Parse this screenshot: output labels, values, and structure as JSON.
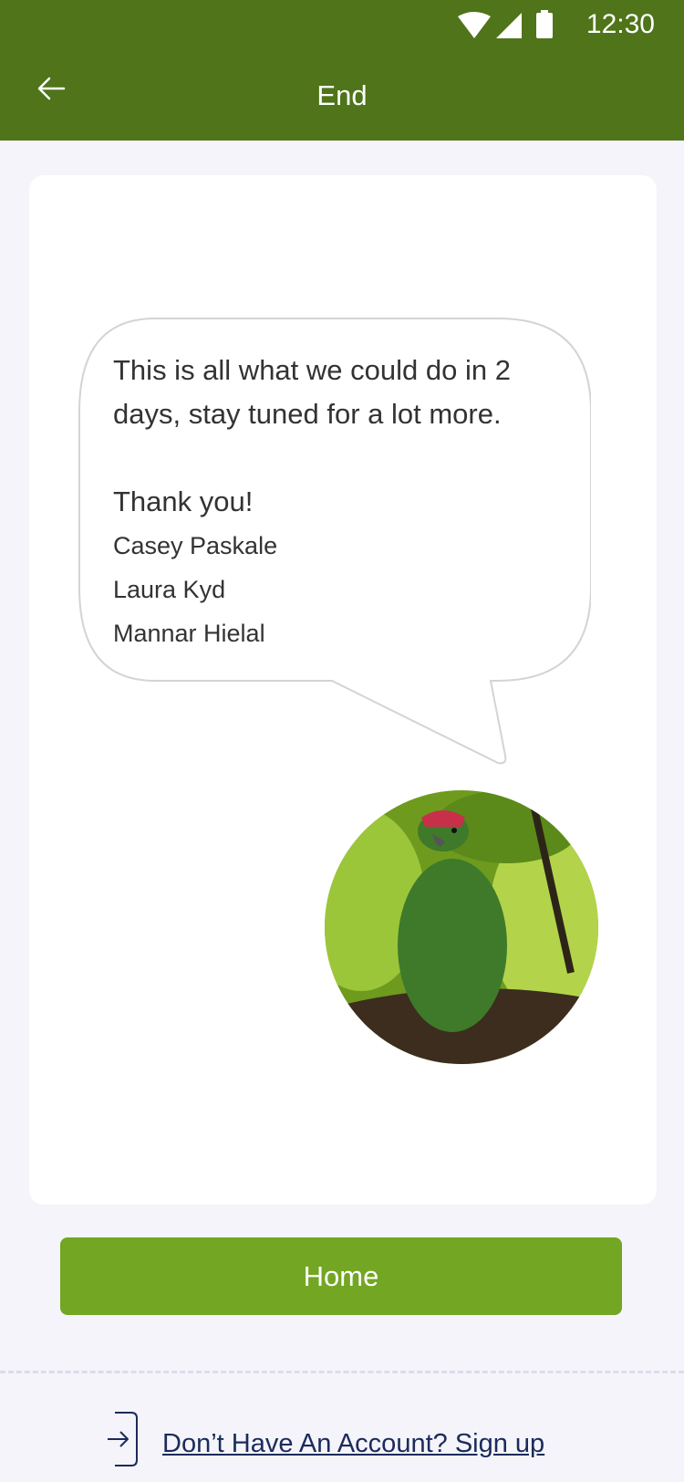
{
  "status_bar": {
    "time": "12:30",
    "icons": [
      "wifi-icon",
      "signal-icon",
      "battery-icon"
    ]
  },
  "header": {
    "title": "End",
    "back_icon": "arrow-left-icon"
  },
  "message": {
    "line1": "This is all what we could do in 2",
    "line2": "days, stay tuned for a lot more.",
    "thanks": "Thank you!",
    "names": [
      "Casey Paskale",
      "Laura Kyd",
      "Mannar Hielal"
    ]
  },
  "avatar": {
    "subject": "green parrot on a branch"
  },
  "home_button": {
    "label": "Home"
  },
  "footer": {
    "signup_text": "Don’t Have An Account? Sign up",
    "icon": "sign-in-icon"
  },
  "colors": {
    "header": "#4f7419",
    "button": "#73a623",
    "link": "#1b2b5a",
    "background": "#f4f4fa"
  }
}
